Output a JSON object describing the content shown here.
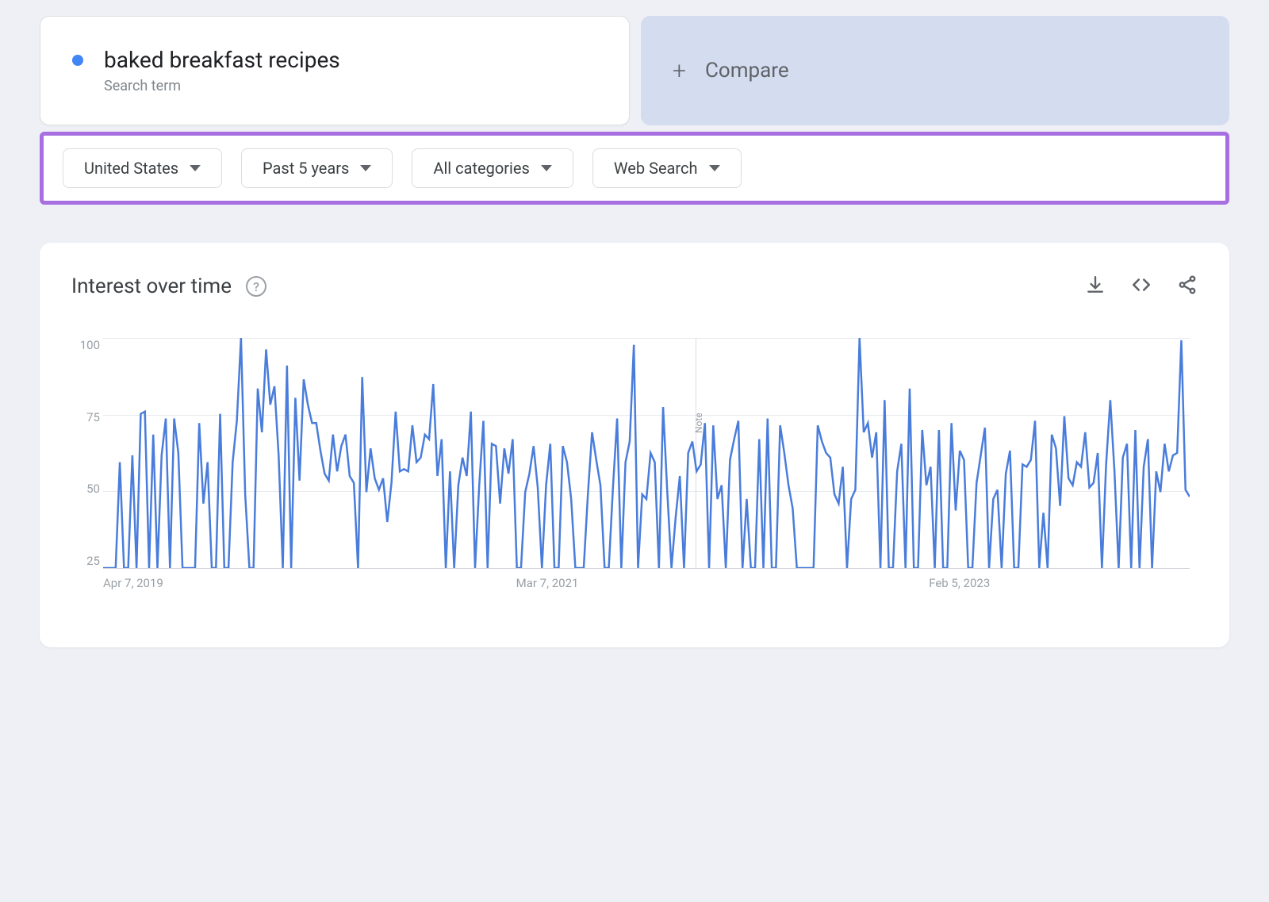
{
  "search": {
    "term": "baked breakfast recipes",
    "type_label": "Search term"
  },
  "compare": {
    "label": "Compare"
  },
  "filters": {
    "region": "United States",
    "timeframe": "Past 5 years",
    "category": "All categories",
    "search_type": "Web Search"
  },
  "chart": {
    "title": "Interest over time",
    "help": "?",
    "y_ticks": [
      "100",
      "75",
      "50",
      "25"
    ],
    "x_labels": {
      "start": "Apr 7, 2019",
      "mid": "Mar 7, 2021",
      "end": "Feb 5, 2023"
    },
    "note": "Note"
  },
  "chart_data": {
    "type": "line",
    "title": "Interest over time",
    "xlabel": "",
    "ylabel": "",
    "ylim": [
      0,
      100
    ],
    "x_range": [
      "2019-04-07",
      "2024-03-31"
    ],
    "x_tick_labels": [
      "Apr 7, 2019",
      "Mar 7, 2021",
      "Feb 5, 2023"
    ],
    "series": [
      {
        "name": "baked breakfast recipes",
        "color": "#4a7ddb",
        "values": [
          0,
          0,
          0,
          0,
          46,
          0,
          0,
          49,
          0,
          67,
          68,
          0,
          58,
          0,
          49,
          65,
          0,
          65,
          50,
          0,
          0,
          0,
          0,
          63,
          28,
          46,
          0,
          0,
          67,
          0,
          0,
          46,
          64,
          100,
          32,
          0,
          0,
          78,
          59,
          95,
          71,
          79,
          49,
          0,
          88,
          0,
          74,
          38,
          82,
          71,
          63,
          63,
          51,
          41,
          38,
          58,
          42,
          53,
          58,
          40,
          37,
          0,
          83,
          33,
          52,
          39,
          34,
          39,
          20,
          37,
          68,
          42,
          43,
          42,
          62,
          46,
          48,
          58,
          56,
          80,
          40,
          56,
          0,
          42,
          0,
          36,
          48,
          40,
          68,
          0,
          36,
          64,
          0,
          54,
          53,
          28,
          52,
          41,
          56,
          0,
          0,
          33,
          41,
          53,
          35,
          0,
          36,
          54,
          0,
          0,
          53,
          46,
          30,
          0,
          0,
          0,
          32,
          59,
          47,
          36,
          0,
          0,
          35,
          65,
          0,
          46,
          55,
          97,
          0,
          32,
          30,
          50,
          46,
          0,
          70,
          33,
          0,
          22,
          40,
          0,
          50,
          55,
          42,
          45,
          63,
          0,
          62,
          30,
          36,
          0,
          47,
          56,
          64,
          0,
          30,
          0,
          0,
          56,
          0,
          65,
          0,
          0,
          62,
          50,
          36,
          26,
          0,
          0,
          0,
          0,
          0,
          62,
          55,
          50,
          48,
          32,
          28,
          44,
          0,
          30,
          34,
          100,
          59,
          63,
          48,
          59,
          0,
          73,
          0,
          0,
          42,
          54,
          0,
          78,
          0,
          0,
          60,
          36,
          44,
          0,
          60,
          0,
          0,
          63,
          25,
          51,
          47,
          0,
          0,
          37,
          49,
          61,
          0,
          30,
          34,
          0,
          41,
          51,
          0,
          0,
          45,
          44,
          47,
          64,
          0,
          24,
          0,
          58,
          52,
          27,
          66,
          39,
          36,
          46,
          44,
          59,
          35,
          37,
          50,
          0,
          45,
          73,
          42,
          0,
          48,
          54,
          0,
          60,
          0,
          44,
          56,
          0,
          42,
          33,
          54,
          42,
          49,
          50,
          99,
          34,
          31
        ]
      }
    ],
    "annotations": [
      {
        "type": "note",
        "x_fraction": 0.545,
        "label": "Note"
      }
    ]
  }
}
